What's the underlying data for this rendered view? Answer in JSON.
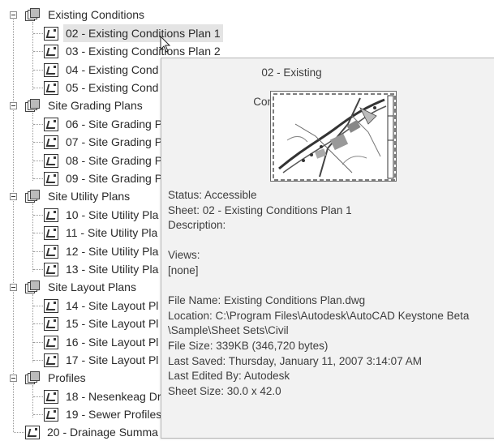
{
  "tree": {
    "groups": [
      {
        "label": "Existing Conditions",
        "sheets": [
          "02 - Existing Conditions Plan 1",
          "03 - Existing Conditions Plan 2",
          "04 - Existing Cond",
          "05 - Existing Cond"
        ]
      },
      {
        "label": "Site Grading Plans",
        "sheets": [
          "06 - Site Grading P",
          "07 - Site Grading P",
          "08 - Site Grading P",
          "09 - Site Grading P"
        ]
      },
      {
        "label": "Site Utility Plans",
        "sheets": [
          "10 - Site Utility Pla",
          "11 - Site Utility Pla",
          "12 - Site Utility Pla",
          "13 - Site Utility Pla"
        ]
      },
      {
        "label": "Site Layout Plans",
        "sheets": [
          "14 - Site Layout Pl",
          "15 - Site Layout Pl",
          "16 - Site Layout Pl",
          "17 - Site Layout Pl"
        ]
      },
      {
        "label": "Profiles",
        "sheets": [
          "18 - Nesenkeag Dr",
          "19 - Sewer Profiles"
        ]
      }
    ],
    "root_sheets": [
      "20 - Drainage Summa"
    ]
  },
  "tooltip": {
    "title": "02 - Existing Conditions Plan 1",
    "status": "Status: Accessible",
    "sheet": "Sheet: 02 - Existing Conditions Plan 1",
    "description": "Description:",
    "views_label": "Views:",
    "views_value": "[none]",
    "file_name": "File Name: Existing Conditions Plan.dwg",
    "location_1": "Location: C:\\Program Files\\Autodesk\\AutoCAD Keystone Beta",
    "location_2": "\\Sample\\Sheet Sets\\Civil",
    "file_size": "File Size: 339KB (346,720 bytes)",
    "last_saved": "Last Saved: Thursday, January 11, 2007  3:14:07 AM",
    "last_edited": "Last Edited By: Autodesk",
    "sheet_size": "Sheet Size: 30.0 x 42.0"
  },
  "icons": {
    "sheet_subset": "sheet-subset-icon",
    "sheet": "sheet-icon",
    "expander": "collapse-toggle-icon",
    "cursor": "mouse-pointer-icon"
  },
  "colors": {
    "selected_background": "#e4e4e4",
    "tooltip_background": "#f2f2f2",
    "tooltip_border": "#b5b5b5"
  }
}
